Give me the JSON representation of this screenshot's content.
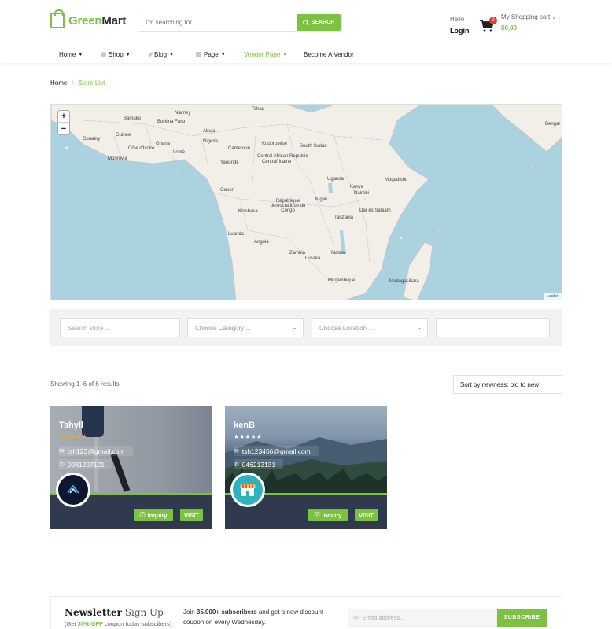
{
  "brand": {
    "name_green": "Green",
    "name_dark": "Mart",
    "accent": "#7cc142"
  },
  "search": {
    "placeholder": "I'm searching for...",
    "button": "SEARCH"
  },
  "account": {
    "hello": "Hello",
    "login": "Login"
  },
  "cart": {
    "count": "0",
    "title": "My Shopping cart",
    "total": "$0,00"
  },
  "nav": {
    "items": [
      {
        "label": "Home"
      },
      {
        "label": "Shop"
      },
      {
        "label": "Blog"
      },
      {
        "label": "Page"
      },
      {
        "label": "Vendor Page"
      },
      {
        "label": "Become A Vendor"
      }
    ]
  },
  "breadcrumb": {
    "home": "Home",
    "separator": "/",
    "current": "Store List"
  },
  "map": {
    "labels": [
      "Niamey",
      "Tchad",
      "Bamako",
      "Burkina Faso",
      "Conakry",
      "Guinée",
      "Côte d'Ivoire",
      "Monrovia",
      "Lomé",
      "Nigeria",
      "Abuja",
      "Ghana",
      "Cameroun",
      "Yaoundé",
      "Gabon",
      "Kinshasa",
      "Kodorosése",
      "Central African Republic",
      "Centrafricaine",
      "South Sudan",
      "Uganda",
      "Kenya",
      "Mogadishu",
      "Nairobi",
      "Kigali",
      "Tanzania",
      "Dar es Salaam",
      "Luanda",
      "Angola",
      "Zambia",
      "Lusaka",
      "Malawi",
      "Moçambique",
      "Madagasikara",
      "République démocratique du Congo",
      "Bengal"
    ],
    "zoom_in": "+",
    "zoom_out": "−",
    "attribution": "Leaflet"
  },
  "filters": {
    "search_placeholder": "Search store ...",
    "category_placeholder": "Choose Category ...",
    "location_placeholder": "Choose Location ..."
  },
  "results": {
    "text": "Showing 1–6 of 6 results",
    "sort": "Sort by newness: old to new"
  },
  "stores": [
    {
      "name": "Tshyll",
      "rating": 5,
      "email": "tsh123@gmail.com",
      "phone": "0981297121",
      "inquiry": "Inquiry",
      "visit": "VISIT"
    },
    {
      "name": "kenB",
      "rating": 0,
      "email": "tsh123456@gmail.com",
      "phone": "046213131",
      "inquiry": "Inquiry",
      "visit": "VISIT"
    }
  ],
  "newsletter": {
    "title_bold": "Newsletter",
    "title_light": "Sign Up",
    "sub_prefix": "(Get ",
    "sub_highlight": "30% OFF",
    "sub_suffix": " coupon today subscibers)",
    "text_prefix": "Join ",
    "text_bold": "35.000+ subscribers",
    "text_suffix": " and get a new discount coupon on every Wednesday.",
    "placeholder": "Email address...",
    "button": "SUBSCRIBE"
  }
}
